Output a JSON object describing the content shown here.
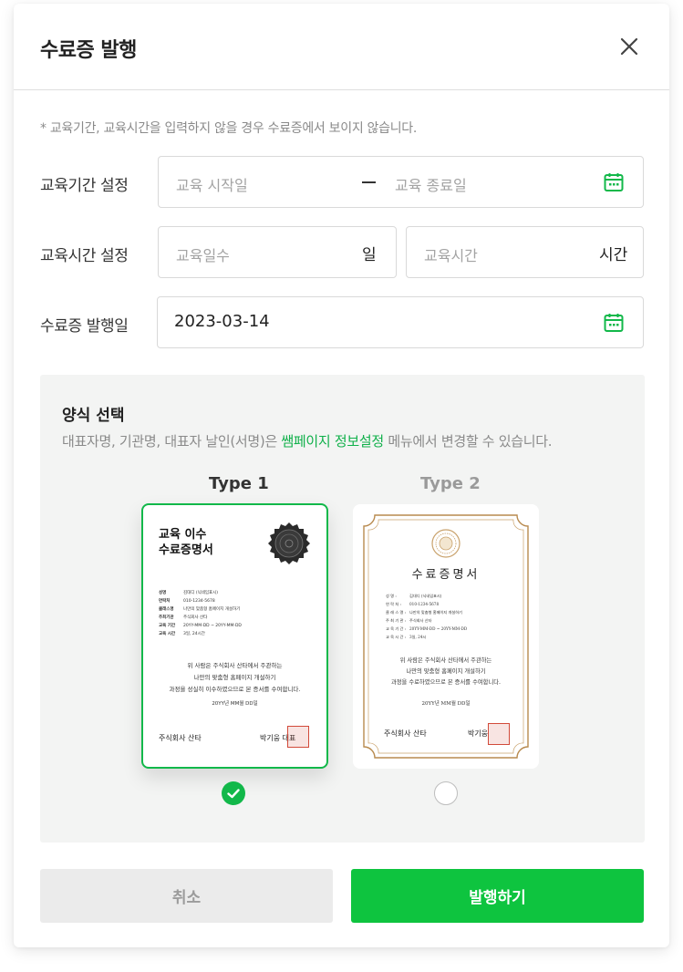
{
  "dialog": {
    "title": "수료증 발행",
    "notice": "* 교육기간, 교육시간을 입력하지 않을 경우 수료증에서 보이지 않습니다."
  },
  "form": {
    "period": {
      "label": "교육기간 설정",
      "start_placeholder": "교육 시작일",
      "end_placeholder": "교육 종료일"
    },
    "hours": {
      "label": "교육시간 설정",
      "days_placeholder": "교육일수",
      "days_unit": "일",
      "hours_placeholder": "교육시간",
      "hours_unit": "시간"
    },
    "issue_date": {
      "label": "수료증 발행일",
      "value": "2023-03-14"
    }
  },
  "template": {
    "title": "양식 선택",
    "desc_before": "대표자명, 기관명, 대표자 날인(서명)은 ",
    "desc_link": "쌤페이지 정보설정",
    "desc_after": " 메뉴에서 변경할 수 있습니다.",
    "selected": "Type 1",
    "types": [
      {
        "label": "Type 1",
        "title_line1": "교육 이수",
        "title_line2": "수료증명서",
        "info": [
          {
            "k": "성명",
            "v": "김대디 (닉네임표시)"
          },
          {
            "k": "연락처",
            "v": "010-1234-5678"
          },
          {
            "k": "클래스명",
            "v": "나만의 맞춤형 홈페이지 개설하기"
          },
          {
            "k": "주최기관",
            "v": "주식회사 산타"
          },
          {
            "k": "교육 기간",
            "v": "20YY-MM-DD ~ 20YY-MM-DD"
          },
          {
            "k": "교육 시간",
            "v": "3일, 24시간"
          }
        ],
        "body_line1": "위 사람은 주식회사 산타에서 주관하는",
        "body_line2": "나만의 맞춤형 홈페이지 개설하기",
        "body_line3": "과정을 성실히 이수하였으므로 본 증서를 수여합니다.",
        "date": "20YY년 MM월 DD일",
        "org": "주식회사 산타",
        "ceo": "박기웅 대표"
      },
      {
        "label": "Type 2",
        "title": "수료증명서",
        "info": [
          {
            "k": "성 명 :",
            "v": "김대디 (닉네임표시)"
          },
          {
            "k": "연 락 처 :",
            "v": "010-1234-5678"
          },
          {
            "k": "클 래 스 명 :",
            "v": "나만의 맞춤형 홈페이지 개설하기"
          },
          {
            "k": "주 최 기 관 :",
            "v": "주식회사 산타"
          },
          {
            "k": "교 육 기 간 :",
            "v": "20YY-MM-DD ~ 20YY-MM-DD"
          },
          {
            "k": "교 육 시 간 :",
            "v": "3일, 24시"
          }
        ],
        "body_line1": "위 사람은 주식회사 산타에서 주관하는",
        "body_line2": "나만의 맞춤형 홈페이지 개설하기",
        "body_line3": "과정을 수료하였으므로 본 증서를 수여합니다.",
        "date": "20YY년 MM월 DD일",
        "org": "주식회사 산타",
        "ceo": "박기웅"
      }
    ]
  },
  "actions": {
    "cancel": "취소",
    "issue": "발행하기"
  },
  "colors": {
    "accent": "#0ec43f",
    "selected_border": "#12b84a",
    "link": "#10b04a",
    "gold": "#b88a4e",
    "stamp": "#d24a3a"
  },
  "icons": {
    "close": "close-icon",
    "calendar": "calendar-icon",
    "check": "check-icon"
  }
}
